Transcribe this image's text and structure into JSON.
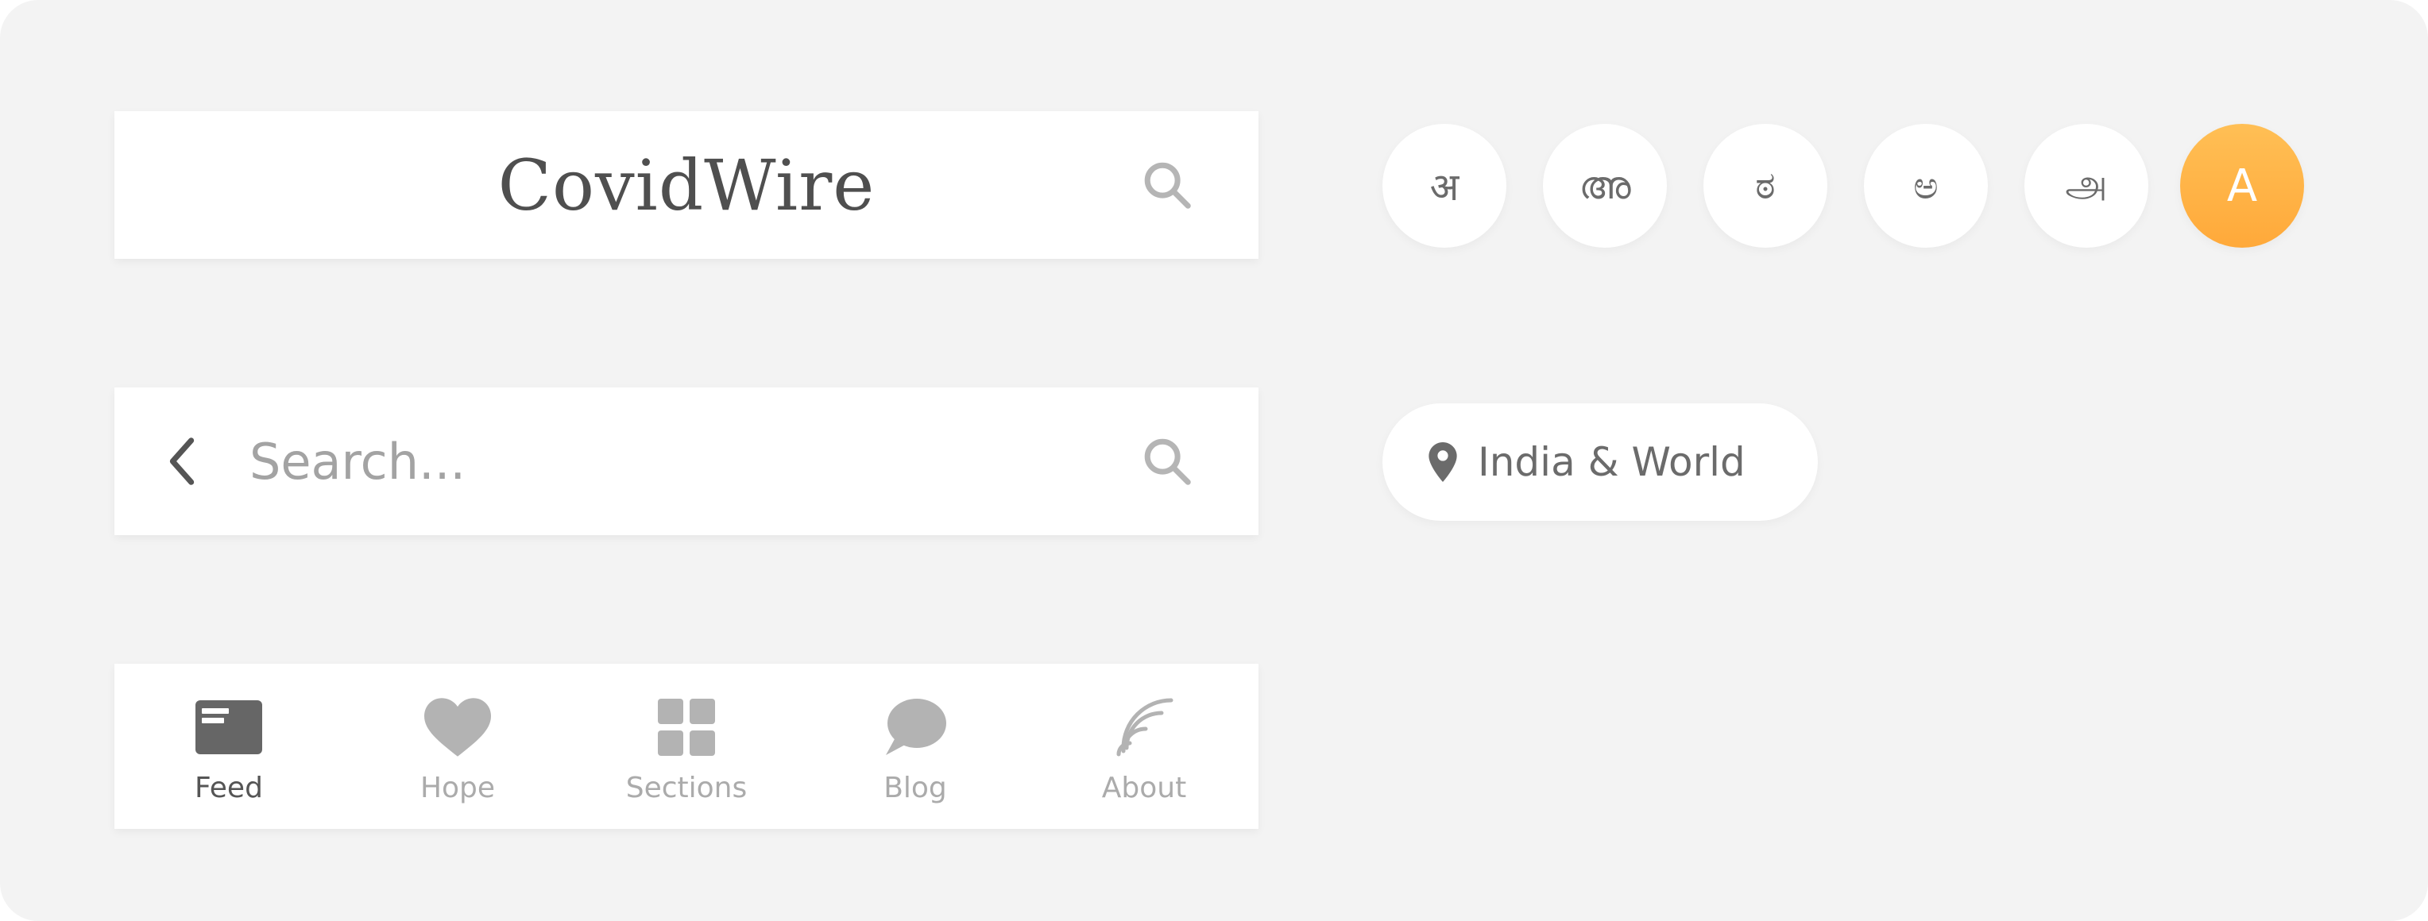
{
  "header": {
    "logo": "CovidWire",
    "search_icon": "search-icon"
  },
  "search_bar": {
    "placeholder": "Search...",
    "value": "",
    "back_icon": "chevron-left-icon",
    "search_icon": "search-icon"
  },
  "bottom_nav": {
    "items": [
      {
        "label": "Feed",
        "icon": "newspaper-icon",
        "active": true
      },
      {
        "label": "Hope",
        "icon": "heart-icon",
        "active": false
      },
      {
        "label": "Sections",
        "icon": "grid-icon",
        "active": false
      },
      {
        "label": "Blog",
        "icon": "chat-bubble-icon",
        "active": false
      },
      {
        "label": "About",
        "icon": "broadcast-icon",
        "active": false
      }
    ]
  },
  "languages": {
    "items": [
      {
        "glyph": "अ",
        "active": false
      },
      {
        "glyph": "അ",
        "active": false
      },
      {
        "glyph": "ಠ",
        "active": false
      },
      {
        "glyph": "ಅ",
        "active": false
      },
      {
        "glyph": "அ",
        "active": false
      },
      {
        "glyph": "A",
        "active": true
      }
    ]
  },
  "location": {
    "label": "India & World",
    "icon": "location-pin-icon"
  },
  "colors": {
    "background": "#f3f3f3",
    "accent": "#ffb347",
    "text_dark": "#4f4f4f",
    "text_muted": "#ababab"
  }
}
